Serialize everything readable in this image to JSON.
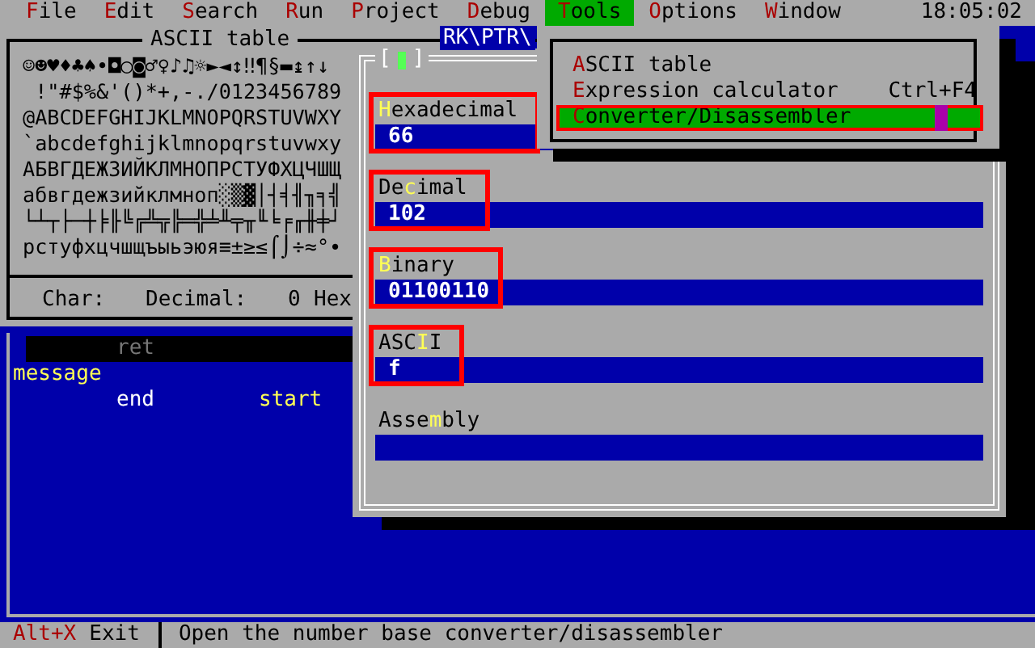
{
  "menu_bar": {
    "items": [
      {
        "key": "F",
        "rest": "ile",
        "selected": false
      },
      {
        "key": "E",
        "rest": "dit",
        "selected": false
      },
      {
        "key": "S",
        "rest": "earch",
        "selected": false
      },
      {
        "key": "R",
        "rest": "un",
        "selected": false
      },
      {
        "key": "P",
        "rest": "roject",
        "selected": false
      },
      {
        "key": "D",
        "rest": "ebug",
        "selected": false
      },
      {
        "key": "T",
        "rest": "ools",
        "selected": true
      },
      {
        "key": "O",
        "rest": "ptions",
        "selected": false
      },
      {
        "key": "W",
        "rest": "indow",
        "selected": false
      }
    ],
    "clock": "18:05:02"
  },
  "ascii_table": {
    "title": "ASCII table",
    "rows": [
      "☺☻♥♦♣♠•◘○◙♂♀♪♫☼►◄↕‼¶§▬↨↑↓",
      " !\"#$%&'()*+,-./0123456789",
      "@ABCDEFGHIJKLMNOPQRSTUVWXY",
      "`abcdefghijklmnopqrstuvwxy",
      "АБВГДЕЖЗИЙКЛМНОПРСТУФХЦЧШЩ",
      "абвгдежзийклмноп░▒▓│┤╡╢╖╕╣",
      "└┴┬├─┼╞╟╚╔╩╦╠═╬╧╨╤╥╙╘╒╓╫╪┘",
      "рстуфхцчшщъыьэюя≡±≥≤⌠⌡÷≈°∙"
    ],
    "footer": {
      "char_label": "Char:",
      "decimal_label": "Decimal:",
      "decimal_value": "0",
      "hex_label": "Hex"
    }
  },
  "path_tab": "RK\\PTR\\",
  "editor": {
    "lines": [
      {
        "selected": true,
        "tokens": [
          {
            "kind": "instruction",
            "text": "ret"
          }
        ]
      },
      {
        "selected": false,
        "tokens": [
          {
            "kind": "label",
            "text": "message"
          }
        ]
      },
      {
        "selected": false,
        "tokens": [
          {
            "kind": "instruction",
            "text": "end"
          },
          {
            "kind": "operand",
            "text": "start"
          }
        ]
      }
    ]
  },
  "converter": {
    "close_button": {
      "open": "[",
      "close": "]"
    },
    "fields": [
      {
        "key": "H",
        "post": "exadecimal",
        "value": "66",
        "highlighted": true
      },
      {
        "pre": "De",
        "key": "c",
        "post": "imal",
        "value": "102",
        "highlighted": true
      },
      {
        "key": "B",
        "post": "inary",
        "value": "01100110",
        "highlighted": true
      },
      {
        "pre": "ASC",
        "key": "I",
        "post": "I",
        "value": "f",
        "highlighted": true
      },
      {
        "pre": "Asse",
        "key": "m",
        "post": "bly",
        "highlighted": false
      }
    ]
  },
  "tools_menu": {
    "items": [
      {
        "key": "A",
        "rest": "SCII table",
        "selected": false,
        "highlighted": false
      },
      {
        "key": "E",
        "rest": "xpression calculator",
        "shortcut": "Ctrl+F4",
        "selected": false,
        "highlighted": false
      },
      {
        "key": "C",
        "rest": "onverter/Disassembler",
        "selected": true,
        "highlighted": true
      }
    ]
  },
  "status_bar": {
    "hotkey": "Alt+X",
    "action": "Exit",
    "message": "Open the number base converter/disassembler"
  }
}
